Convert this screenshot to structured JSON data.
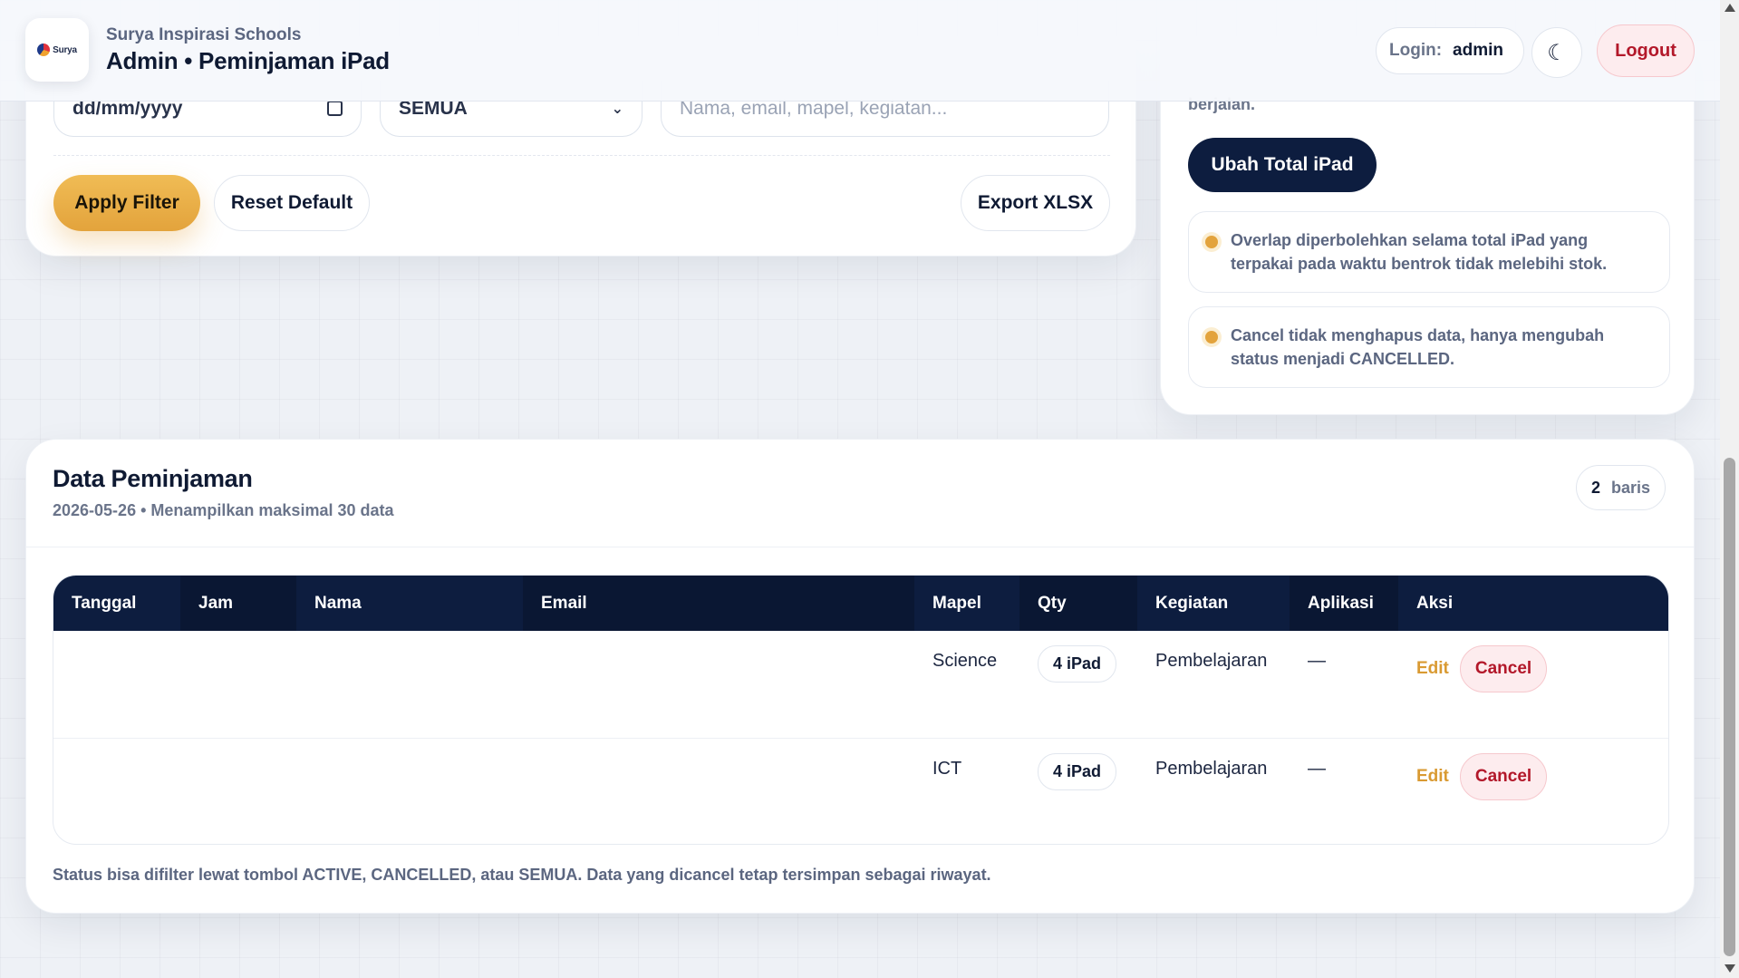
{
  "header": {
    "school": "Surya Inspirasi Schools",
    "title": "Admin • Peminjaman iPad",
    "logo_text": "Surya",
    "login_label": "Login:",
    "login_user": "admin",
    "theme_icon": "☾",
    "logout_label": "Logout"
  },
  "filters": {
    "date_placeholder": "dd/mm/yyyy",
    "status_value": "SEMUA",
    "search_placeholder": "Nama, email, mapel, kegiatan...",
    "apply_label": "Apply Filter",
    "reset_label": "Reset Default",
    "export_label": "Export XLSX"
  },
  "side": {
    "top_text": "berjalan.",
    "ubah_label": "Ubah Total iPad",
    "notes": [
      "Overlap diperbolehkan selama total iPad yang terpakai pada waktu bentrok tidak melebihi stok.",
      "Cancel tidak menghapus data, hanya mengubah status menjadi CANCELLED."
    ]
  },
  "data": {
    "title": "Data Peminjaman",
    "subtitle": "2026-05-26 • Menampilkan maksimal 30 data",
    "row_count": "2",
    "row_label": "baris",
    "columns": [
      "Tanggal",
      "Jam",
      "Nama",
      "Email",
      "Mapel",
      "Qty",
      "Kegiatan",
      "Aplikasi",
      "Aksi"
    ],
    "rows": [
      {
        "tanggal": "",
        "jam": "",
        "nama": "",
        "email": "",
        "mapel": "Science",
        "qty": "4 iPad",
        "kegiatan": "Pembelajaran",
        "aplikasi": "—",
        "edit": "Edit",
        "cancel": "Cancel"
      },
      {
        "tanggal": "",
        "jam": "",
        "nama": "",
        "email": "",
        "mapel": "ICT",
        "qty": "4 iPad",
        "kegiatan": "Pembelajaran",
        "aplikasi": "—",
        "edit": "Edit",
        "cancel": "Cancel"
      }
    ],
    "footnote": "Status bisa difilter lewat tombol ACTIVE, CANCELLED, atau SEMUA. Data yang dicancel tetap tersimpan sebagai riwayat."
  },
  "colors": {
    "accent": "#e3a33c",
    "navy": "#0d1d3f",
    "danger": "#b3182a"
  }
}
